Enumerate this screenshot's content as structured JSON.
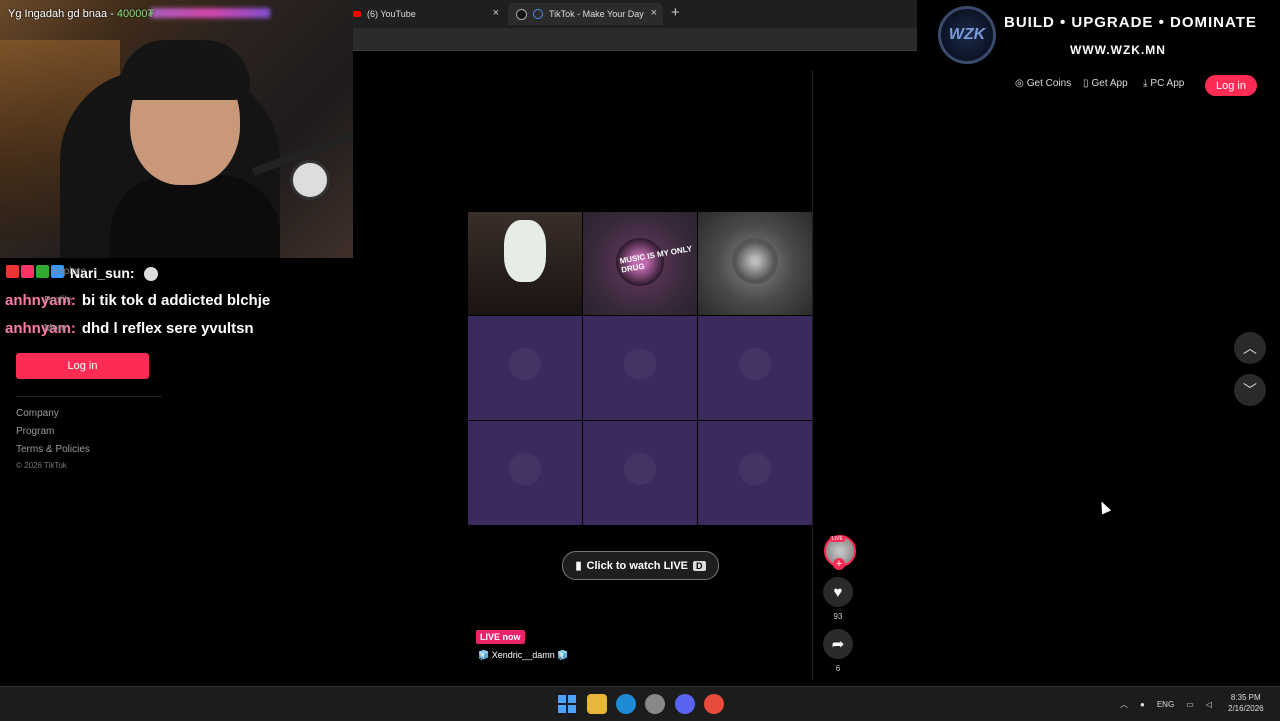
{
  "browser": {
    "tabs": [
      {
        "title": "(6) YouTube"
      },
      {
        "title": "TikTok - Make Your Day"
      }
    ],
    "close_glyph": "×",
    "new_tab_glyph": "+"
  },
  "webcam": {
    "ticker_text": "Yg Ingadah gd bnaa - ",
    "ticker_amount": "40000₮"
  },
  "chat": [
    {
      "user": "Nari_sun:",
      "message": ""
    },
    {
      "user": "anhnyam:",
      "message": "bi tik tok d addicted blchje"
    },
    {
      "user": "anhnyam:",
      "message": "dhd l reflex sere yvultsn"
    }
  ],
  "sidebar": {
    "ghost_items": [
      "Explore",
      "Profile",
      "More"
    ],
    "login_label": "Log in",
    "footer_links": [
      "Company",
      "Program",
      "Terms & Policies"
    ],
    "copyright": "© 2026 TikTok"
  },
  "video": {
    "music_caption": "MUSIC IS MY ONLY DRUG",
    "watch_live_label": "Click to watch LIVE",
    "watch_live_key": "D",
    "live_badge": "LIVE now",
    "streamer_name": "🧊 Xendric__damn 🧊"
  },
  "actions": {
    "avatar_badge": "LIVE",
    "follow_glyph": "+",
    "like_count": "93",
    "share_count": "6"
  },
  "header": {
    "logo_text": "WZK",
    "tagline": "BUILD • UPGRADE • DOMINATE",
    "url": "WWW.WZK.MN",
    "get_coins": "Get Coins",
    "get_app": "Get App",
    "pc_app": "PC App",
    "login": "Log in"
  },
  "taskbar": {
    "language": "ENG",
    "time": "8:35 PM",
    "date": "2/16/2026"
  },
  "colors": {
    "tiktok_pink": "#fe2c55",
    "grid_empty": "#3a2a5e",
    "live_badge": "#e8246a"
  }
}
